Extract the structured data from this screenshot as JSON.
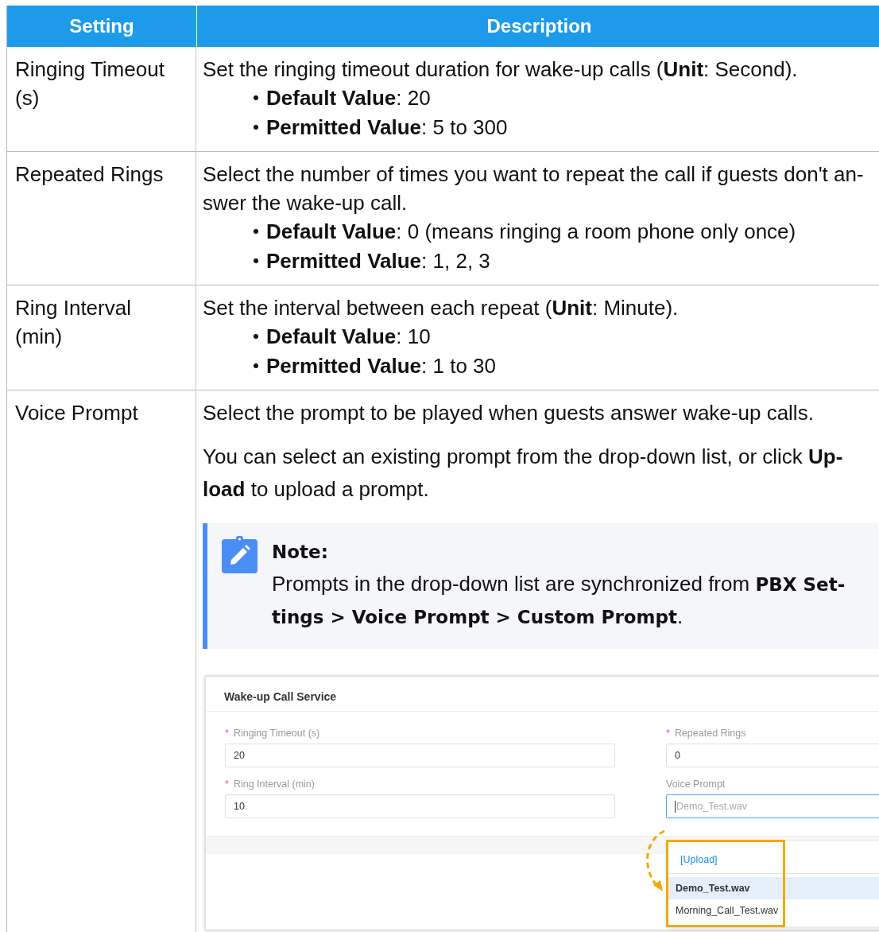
{
  "table": {
    "columns": [
      "Setting",
      "Description"
    ],
    "rows": [
      {
        "setting": "Ringing Timeout (s)",
        "blocks": [
          {
            "kind": "paragraph",
            "text": "Set the ringing timeout duration for wake-up calls (**Unit**: Second)."
          },
          {
            "kind": "bullet",
            "text": "**Default Value**: 20"
          },
          {
            "kind": "bullet",
            "text": "**Permitted Value**: 5 to 300"
          }
        ]
      },
      {
        "setting": "Repeated Rings",
        "blocks": [
          {
            "kind": "paragraph",
            "text": "Select the number of times you want to repeat the call if guests don't an-swer the wake-up call."
          },
          {
            "kind": "bullet",
            "text": "**Default Value**: 0 (means ringing a room phone only once)"
          },
          {
            "kind": "bullet",
            "text": "**Permitted Value**: 1, 2, 3"
          }
        ]
      },
      {
        "setting": "Ring Interval (min)",
        "blocks": [
          {
            "kind": "paragraph",
            "text": "Set the interval between each repeat (**Unit**: Minute)."
          },
          {
            "kind": "bullet",
            "text": "**Default Value**: 10"
          },
          {
            "kind": "bullet",
            "text": "**Permitted Value**: 1 to 30"
          }
        ]
      },
      {
        "setting": "Voice Prompt",
        "blocks": [
          {
            "kind": "paragraph",
            "text": "Select the prompt to be played when guests answer wake-up calls."
          },
          {
            "kind": "paragraph",
            "text": "You can select an existing prompt from the drop-down list, or click **Up-load** to upload a prompt."
          },
          {
            "kind": "note",
            "title": "Note:",
            "text": "Prompts in the drop-down list are synchronized from **PBX Set-tings > Voice Prompt > Custom Prompt**."
          },
          {
            "kind": "screenshot",
            "title": "Wake-up Call Service",
            "fields": [
              {
                "label": "Ringing Timeout (s)",
                "required_mark": "*",
                "value": "20"
              },
              {
                "label": "Repeated Rings",
                "required_mark": "*",
                "value": "0"
              },
              {
                "label": "Ring Interval (min)",
                "required_mark": "*",
                "value": "10"
              },
              {
                "label": "Voice Prompt",
                "placeholder": "Demo_Test.wav",
                "focused": true
              }
            ],
            "dropdown": {
              "action": "[Upload]",
              "options": [
                {
                  "label": "Demo_Test.wav",
                  "selected": true
                },
                {
                  "label": "Morning_Call_Test.wav",
                  "selected": false
                }
              ]
            }
          }
        ]
      }
    ]
  }
}
